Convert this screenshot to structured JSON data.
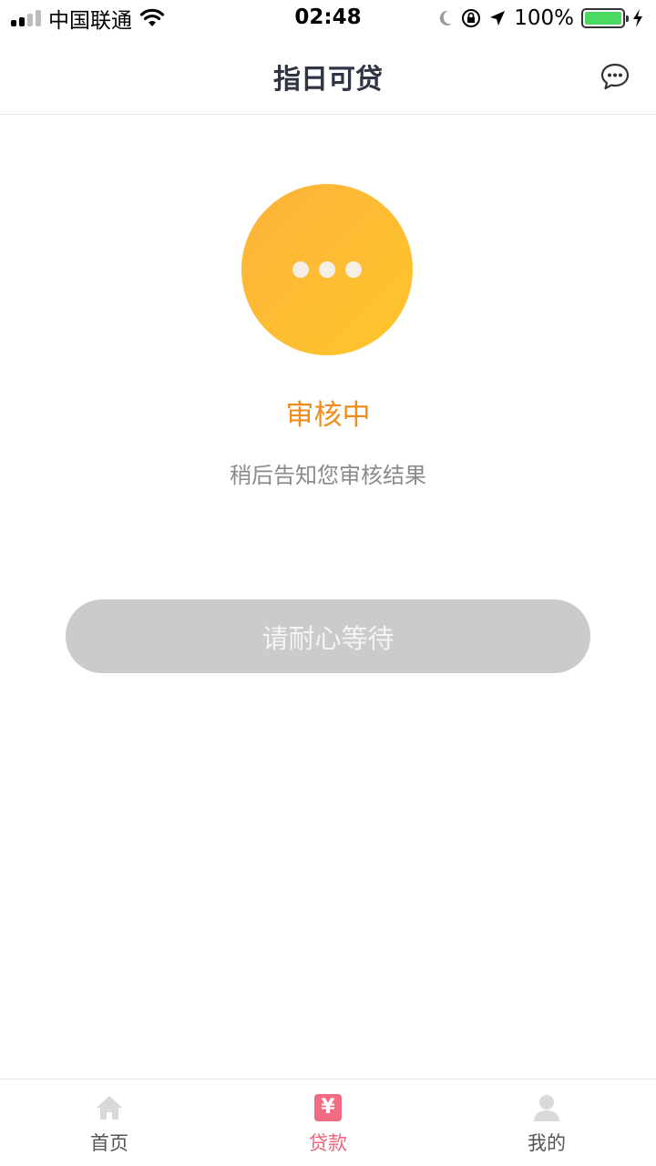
{
  "status_bar": {
    "carrier": "中国联通",
    "time": "02:48",
    "battery_percent": "100%"
  },
  "nav": {
    "title": "指日可贷",
    "chat_icon": "chat-bubble-icon"
  },
  "review": {
    "status": "审核中",
    "description": "稍后告知您审核结果",
    "button_label": "请耐心等待"
  },
  "colors": {
    "accent_orange": "#f08c1c",
    "circle_gradient_start": "#fdb23a",
    "circle_gradient_end": "#ffc62c",
    "tab_active": "#f1637a",
    "button_disabled": "#cbcbcd"
  },
  "tabs": [
    {
      "label": "首页",
      "icon": "home-icon",
      "active": false
    },
    {
      "label": "贷款",
      "icon": "yen-icon",
      "icon_text": "¥",
      "active": true
    },
    {
      "label": "我的",
      "icon": "user-icon",
      "active": false
    }
  ]
}
